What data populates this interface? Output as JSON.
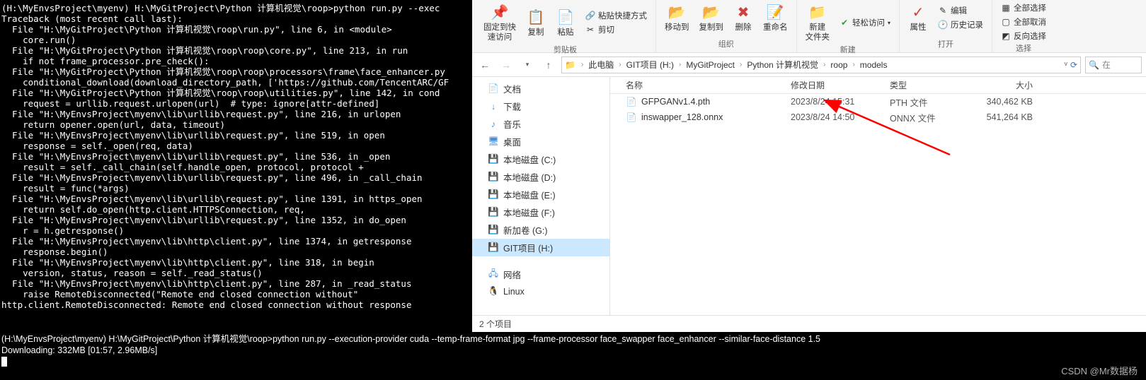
{
  "terminal_top": "(H:\\MyEnvsProject\\myenv) H:\\MyGitProject\\Python 计算机视觉\\roop>python run.py --exec\nTraceback (most recent call last):\n  File \"H:\\MyGitProject\\Python 计算机视觉\\roop\\run.py\", line 6, in <module>\n    core.run()\n  File \"H:\\MyGitProject\\Python 计算机视觉\\roop\\roop\\core.py\", line 213, in run\n    if not frame_processor.pre_check():\n  File \"H:\\MyGitProject\\Python 计算机视觉\\roop\\roop\\processors\\frame\\face_enhancer.py\n    conditional_download(download_directory_path, ['https://github.com/TencentARC/GF\n  File \"H:\\MyGitProject\\Python 计算机视觉\\roop\\roop\\utilities.py\", line 142, in cond\n    request = urllib.request.urlopen(url)  # type: ignore[attr-defined]\n  File \"H:\\MyEnvsProject\\myenv\\lib\\urllib\\request.py\", line 216, in urlopen\n    return opener.open(url, data, timeout)\n  File \"H:\\MyEnvsProject\\myenv\\lib\\urllib\\request.py\", line 519, in open\n    response = self._open(req, data)\n  File \"H:\\MyEnvsProject\\myenv\\lib\\urllib\\request.py\", line 536, in _open\n    result = self._call_chain(self.handle_open, protocol, protocol +\n  File \"H:\\MyEnvsProject\\myenv\\lib\\urllib\\request.py\", line 496, in _call_chain\n    result = func(*args)\n  File \"H:\\MyEnvsProject\\myenv\\lib\\urllib\\request.py\", line 1391, in https_open\n    return self.do_open(http.client.HTTPSConnection, req,\n  File \"H:\\MyEnvsProject\\myenv\\lib\\urllib\\request.py\", line 1352, in do_open\n    r = h.getresponse()\n  File \"H:\\MyEnvsProject\\myenv\\lib\\http\\client.py\", line 1374, in getresponse\n    response.begin()\n  File \"H:\\MyEnvsProject\\myenv\\lib\\http\\client.py\", line 318, in begin\n    version, status, reason = self._read_status()\n  File \"H:\\MyEnvsProject\\myenv\\lib\\http\\client.py\", line 287, in _read_status\n    raise RemoteDisconnected(\"Remote end closed connection without\"\nhttp.client.RemoteDisconnected: Remote end closed connection without response",
  "terminal_bottom": "(H:\\MyEnvsProject\\myenv) H:\\MyGitProject\\Python 计算机视觉\\roop>python run.py --execution-provider cuda --temp-frame-format jpg --frame-processor face_swapper face_enhancer --similar-face-distance 1.5\nDownloading: 332MB [01:57, 2.96MB/s]",
  "ribbon": {
    "pin": {
      "label1": "固定到快",
      "label2": "速访问"
    },
    "copy": "复制",
    "paste": "粘贴",
    "paste_shortcut": "粘贴快捷方式",
    "cut": "剪切",
    "clipboard_label": "剪贴板",
    "move_to": "移动到",
    "copy_to": "复制到",
    "delete": "删除",
    "rename": "重命名",
    "organize_label": "组织",
    "new_folder": {
      "l1": "新建",
      "l2": "文件夹"
    },
    "easy_access": "轻松访问",
    "new_label": "新建",
    "properties": "属性",
    "edit": "编辑",
    "history": "历史记录",
    "open_label": "打开",
    "select_all": "全部选择",
    "select_none": "全部取消",
    "invert_selection": "反向选择",
    "select_label": "选择"
  },
  "breadcrumb": {
    "items": [
      "此电脑",
      "GIT项目 (H:)",
      "MyGitProject",
      "Python 计算机视觉",
      "roop",
      "models"
    ]
  },
  "search_placeholder": "在",
  "sidebar": {
    "items": [
      {
        "label": "文档",
        "icon": "📄",
        "color": "#4a90d9"
      },
      {
        "label": "下载",
        "icon": "↓",
        "color": "#4a90d9"
      },
      {
        "label": "音乐",
        "icon": "♪",
        "color": "#4a90d9"
      },
      {
        "label": "桌面",
        "icon": "🖥",
        "color": "#4a90d9"
      },
      {
        "label": "本地磁盘 (C:)",
        "icon": "💾",
        "color": "#888"
      },
      {
        "label": "本地磁盘 (D:)",
        "icon": "💾",
        "color": "#888"
      },
      {
        "label": "本地磁盘 (E:)",
        "icon": "💾",
        "color": "#888"
      },
      {
        "label": "本地磁盘 (F:)",
        "icon": "💾",
        "color": "#888"
      },
      {
        "label": "新加卷 (G:)",
        "icon": "💾",
        "color": "#888"
      },
      {
        "label": "GIT项目 (H:)",
        "icon": "💾",
        "color": "#888",
        "selected": true
      },
      {
        "label": "网络",
        "icon": "🖧",
        "color": "#4a90d9",
        "spacer": true
      },
      {
        "label": "Linux",
        "icon": "🐧",
        "color": "#333"
      }
    ]
  },
  "headers": {
    "name": "名称",
    "date": "修改日期",
    "type": "类型",
    "size": "大小"
  },
  "files": [
    {
      "name": "GFPGANv1.4.pth",
      "date": "2023/8/24 15:31",
      "type": "PTH 文件",
      "size": "340,462 KB"
    },
    {
      "name": "inswapper_128.onnx",
      "date": "2023/8/24 14:50",
      "type": "ONNX 文件",
      "size": "541,264 KB"
    }
  ],
  "status": "2 个项目",
  "watermark": "CSDN @Mr数据杨"
}
